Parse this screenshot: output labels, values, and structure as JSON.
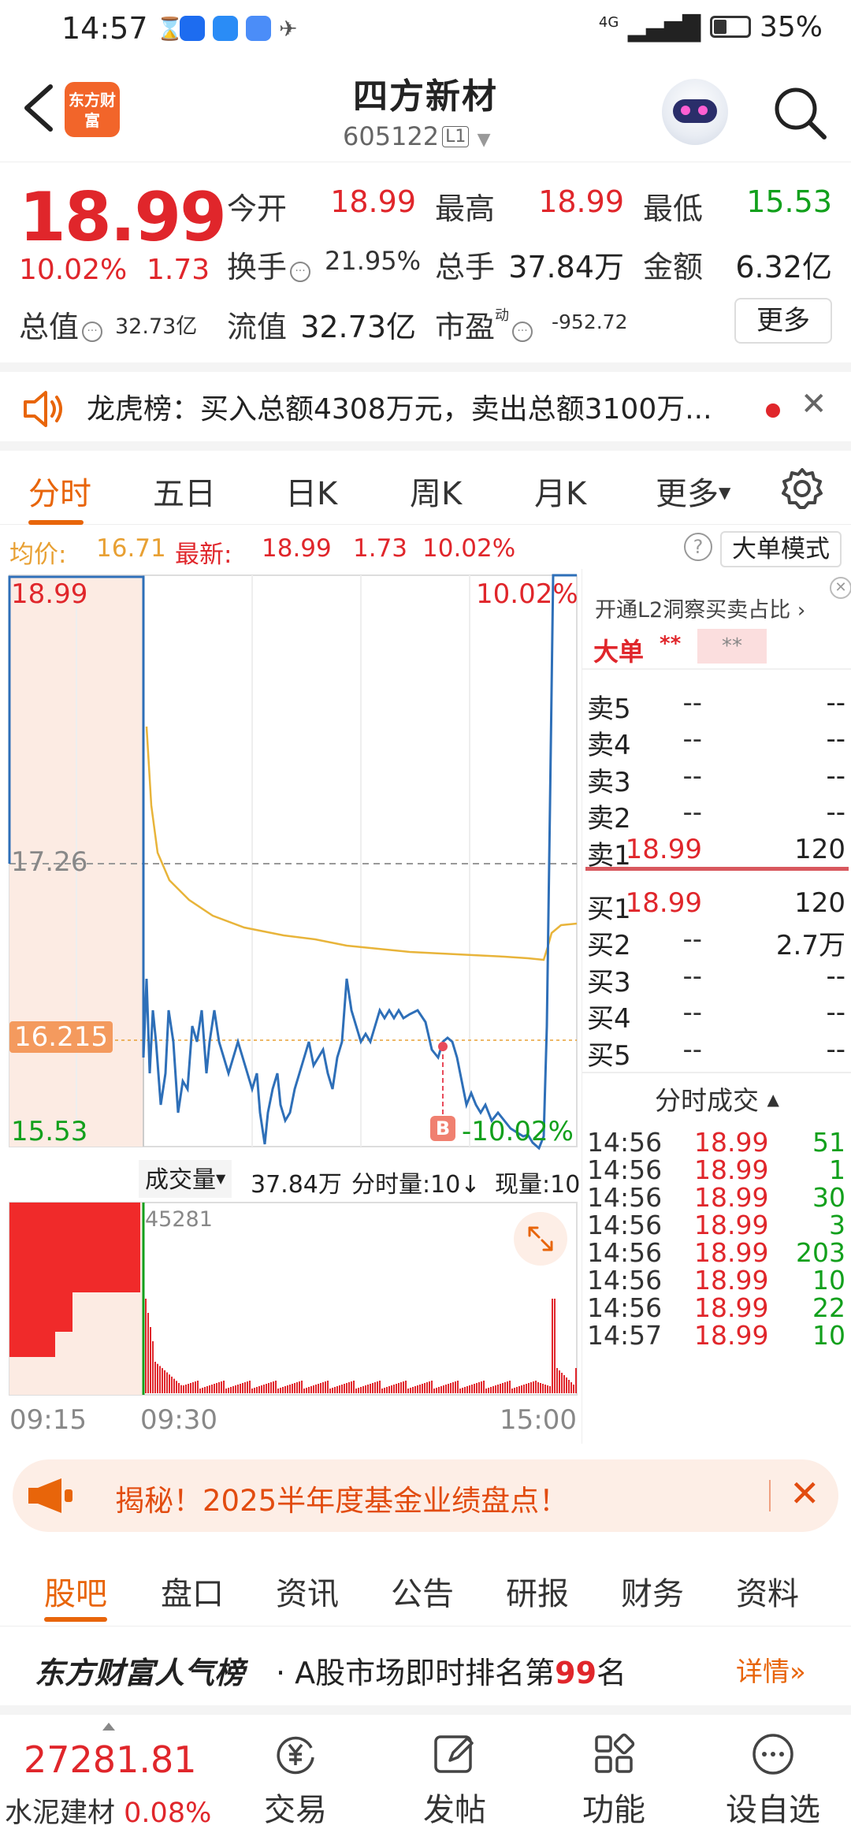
{
  "status_bar": {
    "time": "14:57",
    "signal": "4G",
    "battery": "35%"
  },
  "header": {
    "title": "四方新材",
    "code": "605122",
    "level": "L1",
    "logo_text": "东方财富"
  },
  "quote": {
    "price": "18.99",
    "change_pct": "10.02%",
    "change": "1.73",
    "open_label": "今开",
    "open": "18.99",
    "high_label": "最高",
    "high": "18.99",
    "low_label": "最低",
    "low": "15.53",
    "turnover_label": "换手",
    "turnover": "21.95%",
    "volume_label": "总手",
    "volume": "37.84万",
    "amount_label": "金额",
    "amount": "6.32亿",
    "mktcap_label": "总值",
    "mktcap": "32.73亿",
    "float_label": "流值",
    "float": "32.73亿",
    "pe_label": "市盈",
    "pe_sup": "动",
    "pe": "-952.72",
    "more": "更多"
  },
  "dragon_tiger": {
    "text": "龙虎榜：买入总额4308万元，卖出总额3100万..."
  },
  "chart_tabs": {
    "items": [
      "分时",
      "五日",
      "日K",
      "周K",
      "月K",
      "更多"
    ]
  },
  "info_line": {
    "avg_label": "均价:",
    "avg": "16.71",
    "latest_label": "最新:",
    "latest": "18.99",
    "change": "1.73",
    "pct": "10.02%",
    "big_order_mode": "大单模式"
  },
  "chart_labels": {
    "top_price": "18.99",
    "top_pct": "10.02%",
    "mid_price": "17.26",
    "cursor_price": "16.215",
    "low_price": "15.53",
    "low_pct": "-10.02%",
    "b_marker": "B",
    "vol_label": "成交量",
    "vol_total": "37.84万",
    "tick_vol_label": "分时量:10↓",
    "cur_vol_label": "现量:10",
    "vol_max": "45281",
    "time_start": "09:15",
    "time_mid": "09:30",
    "time_end": "15:00"
  },
  "chart_data": {
    "type": "line",
    "prev_close": 17.26,
    "ylim": [
      15.53,
      18.99
    ],
    "x_ticks": [
      "09:15",
      "09:30",
      "15:00"
    ],
    "series": [],
    "volume_max": 45281
  },
  "order_book": {
    "l2_promo": "开通L2洞察买卖占比",
    "big_label": "大单",
    "big_val1": "**",
    "big_val2": "**",
    "asks": [
      {
        "label": "卖5",
        "price": "--",
        "vol": "--"
      },
      {
        "label": "卖4",
        "price": "--",
        "vol": "--"
      },
      {
        "label": "卖3",
        "price": "--",
        "vol": "--"
      },
      {
        "label": "卖2",
        "price": "--",
        "vol": "--"
      },
      {
        "label": "卖1",
        "price": "18.99",
        "vol": "120"
      }
    ],
    "bids": [
      {
        "label": "买1",
        "price": "18.99",
        "vol": "120"
      },
      {
        "label": "买2",
        "price": "--",
        "vol": "2.7万"
      },
      {
        "label": "买3",
        "price": "--",
        "vol": "--"
      },
      {
        "label": "买4",
        "price": "--",
        "vol": "--"
      },
      {
        "label": "买5",
        "price": "--",
        "vol": "--"
      }
    ],
    "trades_title": "分时成交",
    "trades": [
      {
        "time": "14:56",
        "price": "18.99",
        "vol": "51"
      },
      {
        "time": "14:56",
        "price": "18.99",
        "vol": "1"
      },
      {
        "time": "14:56",
        "price": "18.99",
        "vol": "30"
      },
      {
        "time": "14:56",
        "price": "18.99",
        "vol": "3"
      },
      {
        "time": "14:56",
        "price": "18.99",
        "vol": "203"
      },
      {
        "time": "14:56",
        "price": "18.99",
        "vol": "10"
      },
      {
        "time": "14:56",
        "price": "18.99",
        "vol": "22"
      },
      {
        "time": "14:57",
        "price": "18.99",
        "vol": "10"
      }
    ]
  },
  "promo": {
    "text": "揭秘！2025半年度基金业绩盘点！"
  },
  "bottom_tabs": {
    "items": [
      "股吧",
      "盘口",
      "资讯",
      "公告",
      "研报",
      "财务",
      "资料"
    ]
  },
  "popularity": {
    "brand": "东方财富人气榜",
    "desc_prefix": "· A股市场即时排名第",
    "rank": "99",
    "desc_suffix": "名",
    "details": "详情"
  },
  "bottom_nav": {
    "index_value": "27281.81",
    "index_name": "水泥建材",
    "index_pct": "0.08%",
    "items": [
      {
        "label": "交易",
        "icon": "yuan-cycle-icon"
      },
      {
        "label": "发帖",
        "icon": "edit-icon"
      },
      {
        "label": "功能",
        "icon": "grid-icon"
      },
      {
        "label": "设自选",
        "icon": "more-dots-icon"
      }
    ]
  }
}
